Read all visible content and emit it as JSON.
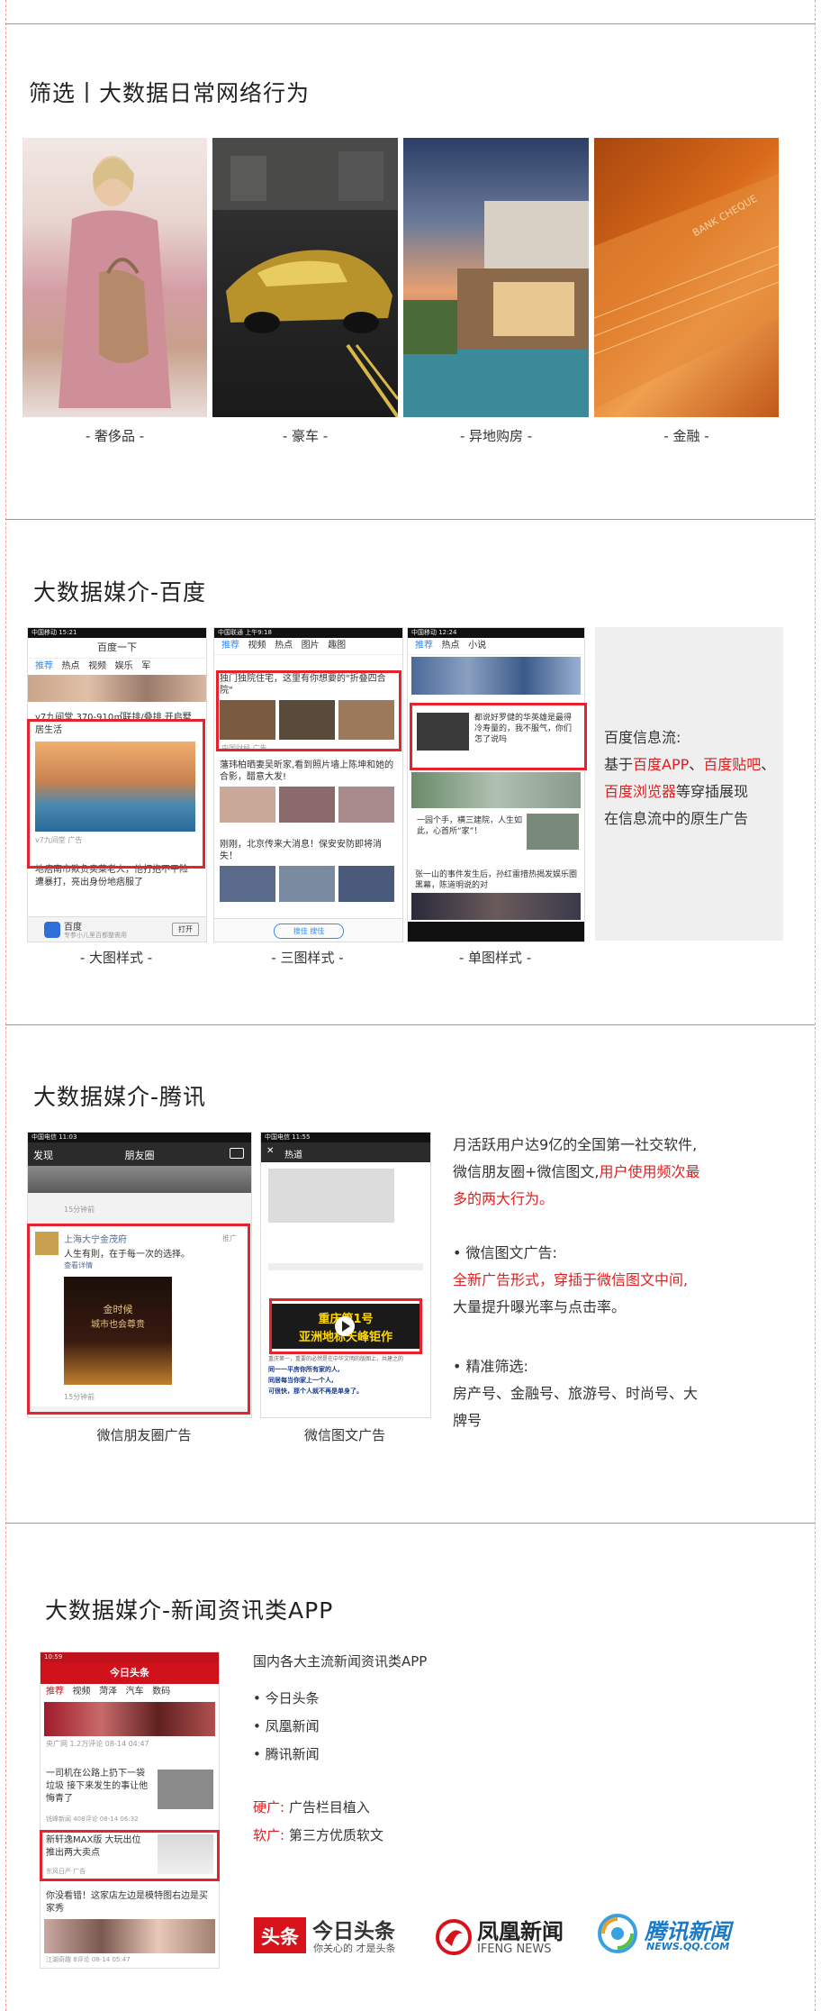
{
  "section1": {
    "title": "筛选丨大数据日常网络行为",
    "captions": [
      "- 奢侈品 -",
      "- 豪车 -",
      "- 异地购房 -",
      "- 金融 -"
    ],
    "finance_overlay": "BANK CHEQUE"
  },
  "section2": {
    "title": "大数据媒介-百度",
    "captions": [
      "- 大图样式 -",
      "- 三图样式 -",
      "- 单图样式 -"
    ],
    "desc_line1": "百度信息流:",
    "desc_line2_pre": "基于",
    "desc_app": "百度APP",
    "desc_sep": "、",
    "desc_tieba": "百度贴吧",
    "desc_sep2": "、",
    "desc_browser": "百度浏览器",
    "desc_line3_post": "等穿插展现",
    "desc_line4": "在信息流中的原生广告",
    "phone1": {
      "header": "百度一下",
      "tabs": [
        "推荐",
        "热点",
        "视频",
        "娱乐",
        "军"
      ],
      "ad_title": "v7九间堂,370-910㎡联排/叠排,开启墅居生活",
      "ad_source": "v7九间堂 广告",
      "news": "地痞南市欺负卖菜老人，他打抱不平险遭暴打，亮出身份地痞服了",
      "app_name": "百度",
      "app_sub": "专参小儿里百都整需用",
      "open_btn": "打开"
    },
    "phone2": {
      "tabs": [
        "推荐",
        "视频",
        "热点",
        "图片",
        "趣图"
      ],
      "ad_title": "独门独院住宅，这里有你想要的\"折叠四合院\"",
      "ad_source": "中国财经 广告",
      "news1": "藩玮柏晒妻吴昕家,看到照片墙上陈坤和她的合影，醋意大发!",
      "news2": "刚刚，北京传来大消息！保安安防即将消失！",
      "bottom_btn": "搜佳 搜佳"
    },
    "phone3": {
      "tabs": [
        "推荐",
        "热点",
        "小说"
      ],
      "ad_text": "都说好罗健的华英雄是最得冷寿量的，我不服气，你们怎了说吗",
      "news1": "一园个手，横三建院，人生如此，心首所“家”！",
      "news2": "张一山的事件发生后，孙红雷措热揭发娱乐圈黑幕，陈道明说的对"
    }
  },
  "section3": {
    "title": "大数据媒介-腾讯",
    "captions": [
      "微信朋友圈广告",
      "微信图文广告"
    ],
    "desc": {
      "line1": "月活跃用户达9亿的全国第一社交软件,",
      "line2_pre": "微信朋友圈+微信图文,",
      "line2_red": "用户使用频次最",
      "line3_red": "多的两大行为。",
      "bullet1": "•   微信图文广告:",
      "line5_red": "全新广告形式，穿插于微信图文中间,",
      "line6": "大量提升曝光率与点击率。",
      "bullet2": "•   精准筛选:",
      "line8": "房产号、金融号、旅游号、时尚号、大",
      "line9": "牌号"
    },
    "moments": {
      "back": "发现",
      "title": "朋友圈",
      "advertiser": "上海大宁金茂府",
      "ad_tag": "推广",
      "ad_text": "人生有則，在于每一次的选择。",
      "more": "查看详情",
      "poster_line1": "金时候",
      "poster_line2": "城市也会尊贵",
      "time1": "15分钟前",
      "time2": "15分钟前"
    },
    "article": {
      "back": "热道",
      "banner_line1": "重庆第1号",
      "banner_line2": "亚洲地标天峰钜作",
      "line1": "重庆第一，重要的必然是在中华文明的版图上，共建之的",
      "line2": "同一一平房你所有家的人,",
      "line3": "同居每当你家上一个人,",
      "line4": "可很快，那个人就不再是单身了。"
    }
  },
  "section4": {
    "title": "大数据媒介-新闻资讯类APP",
    "desc": {
      "line1": "国内各大主流新闻资讯类APP",
      "item1": "•   今日头条",
      "item2": "•   凤凰新闻",
      "item3": "•   腾讯新闻",
      "hard_label": "硬广:",
      "hard_text": "  广告栏目植入",
      "soft_label": "软广:",
      "soft_text": "  第三方优质软文"
    },
    "phone": {
      "header": "今日头条",
      "tabs": [
        "推荐",
        "视频",
        "菏泽",
        "汽车",
        "数码"
      ],
      "news1": "一司机在公路上扔下一袋垃圾 接下来发生的事让他悔青了",
      "news1_meta": "钱峰新闻 408评论 08-14 06:32",
      "ad": "新轩逸MAX版 大玩出位 推出两大卖点",
      "ad_meta": "东风日产 广告",
      "news2": "你没看错！这家店左边是模特图右边是买家秀",
      "news2_meta": "江湖奇趣 8评论 08-14 05:47",
      "top_meta": "央广网 1.2万评论 08-14 04:47"
    },
    "logos": {
      "toutiao_badge": "头条",
      "toutiao_name": "今日头条",
      "toutiao_slogan": "你关心的 才是头条",
      "ifeng_name": "凤凰新闻",
      "ifeng_en": "IFENG NEWS",
      "qq_name": "腾讯新闻",
      "qq_url": "NEWS.QQ.COM"
    }
  },
  "colors": {
    "accent_red": "#e02020",
    "box_red": "#e8222a"
  }
}
